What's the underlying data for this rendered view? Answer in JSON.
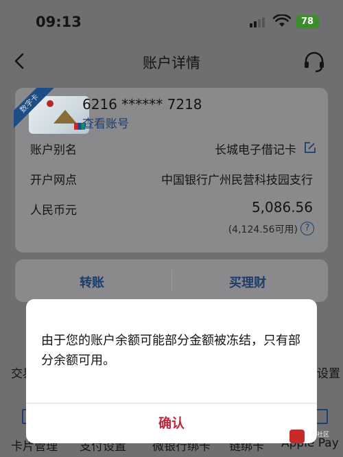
{
  "status_bar": {
    "time": "09:13",
    "battery": "78"
  },
  "header": {
    "title": "账户详情",
    "back_icon": "chevron-left-icon",
    "service_icon": "headset-icon"
  },
  "card": {
    "badge": "数字卡",
    "number": "6216 ****** 7218",
    "view_account_link": "查看账号",
    "rows": [
      {
        "label": "账户别名",
        "value": "长城电子借记卡"
      },
      {
        "label": "开户网点",
        "value": "中国银行广州民营科技园支行"
      },
      {
        "label": "人民币元",
        "value": "5,086.56"
      }
    ],
    "available": "(4,124.56可用)",
    "help_symbol": "?"
  },
  "actions": {
    "transfer": "转账",
    "buy_wealth": "买理财"
  },
  "background_grid": {
    "row1_left": "交易",
    "row1_right": "设置",
    "row2": [
      "卡片管理",
      "支付设置",
      "微银行绑卡",
      "链绑卡",
      "Apple Pay"
    ]
  },
  "dialog": {
    "message": "由于您的账户余额可能部分金额被冻结，只有部分余额可用。",
    "confirm": "确认"
  },
  "watermark": {
    "text": "卡农社区"
  },
  "colors": {
    "accent_blue": "#1c3e6c",
    "confirm_red": "#c1273a",
    "battery_green": "#3e8d2c"
  }
}
